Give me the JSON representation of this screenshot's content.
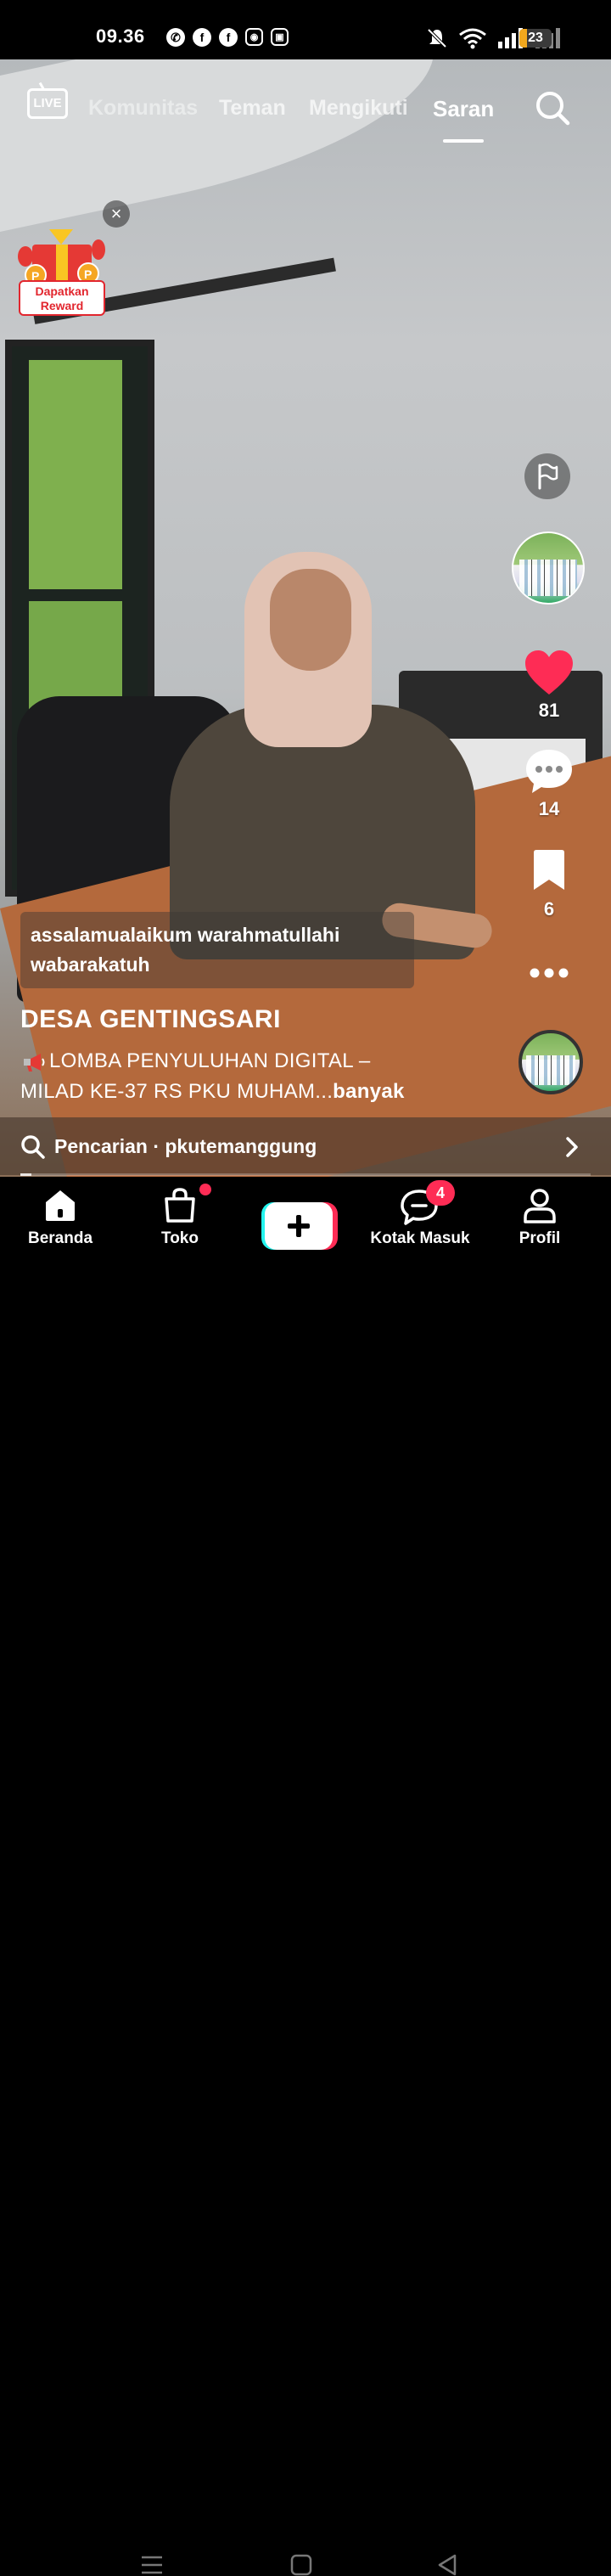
{
  "status_bar": {
    "time": "09.36",
    "app_icons": [
      "whatsapp-icon",
      "facebook-icon",
      "facebook-icon",
      "instagram-icon",
      "sim-icon"
    ],
    "battery_level": "23",
    "battery_color": "#f2a81d"
  },
  "top_tabs": {
    "live_label": "LIVE",
    "tabs": [
      "Komunitas",
      "Teman",
      "Mengikuti",
      "Saran"
    ],
    "active_tab": "Saran"
  },
  "reward": {
    "label_line1": "Dapatkan",
    "label_line2": "Reward",
    "close_glyph": "×"
  },
  "actions": {
    "likes": "81",
    "comments": "14",
    "bookmarks": "6"
  },
  "video": {
    "caption_line1": "assalamualaikum warahmatullahi",
    "caption_line2": "wabarakatuh",
    "author": "DESA GENTINGSARI",
    "description_line1": "LOMBA PENYULUHAN DIGITAL –",
    "description_line2": "MILAD KE-37 RS PKU MUHAM...",
    "more_label": "banyak",
    "playback_progress": 0.02
  },
  "search_suggestion": {
    "text": "Pencarian · pkutemanggung"
  },
  "bottom_nav": {
    "items": [
      {
        "label": "Beranda",
        "icon": "home-icon"
      },
      {
        "label": "Toko",
        "icon": "shop-icon"
      },
      {
        "label": "Kotak Masuk",
        "icon": "inbox-icon"
      },
      {
        "label": "Profil",
        "icon": "profile-icon"
      }
    ],
    "inbox_badge": "4",
    "accent_color": "#fe2c55"
  }
}
